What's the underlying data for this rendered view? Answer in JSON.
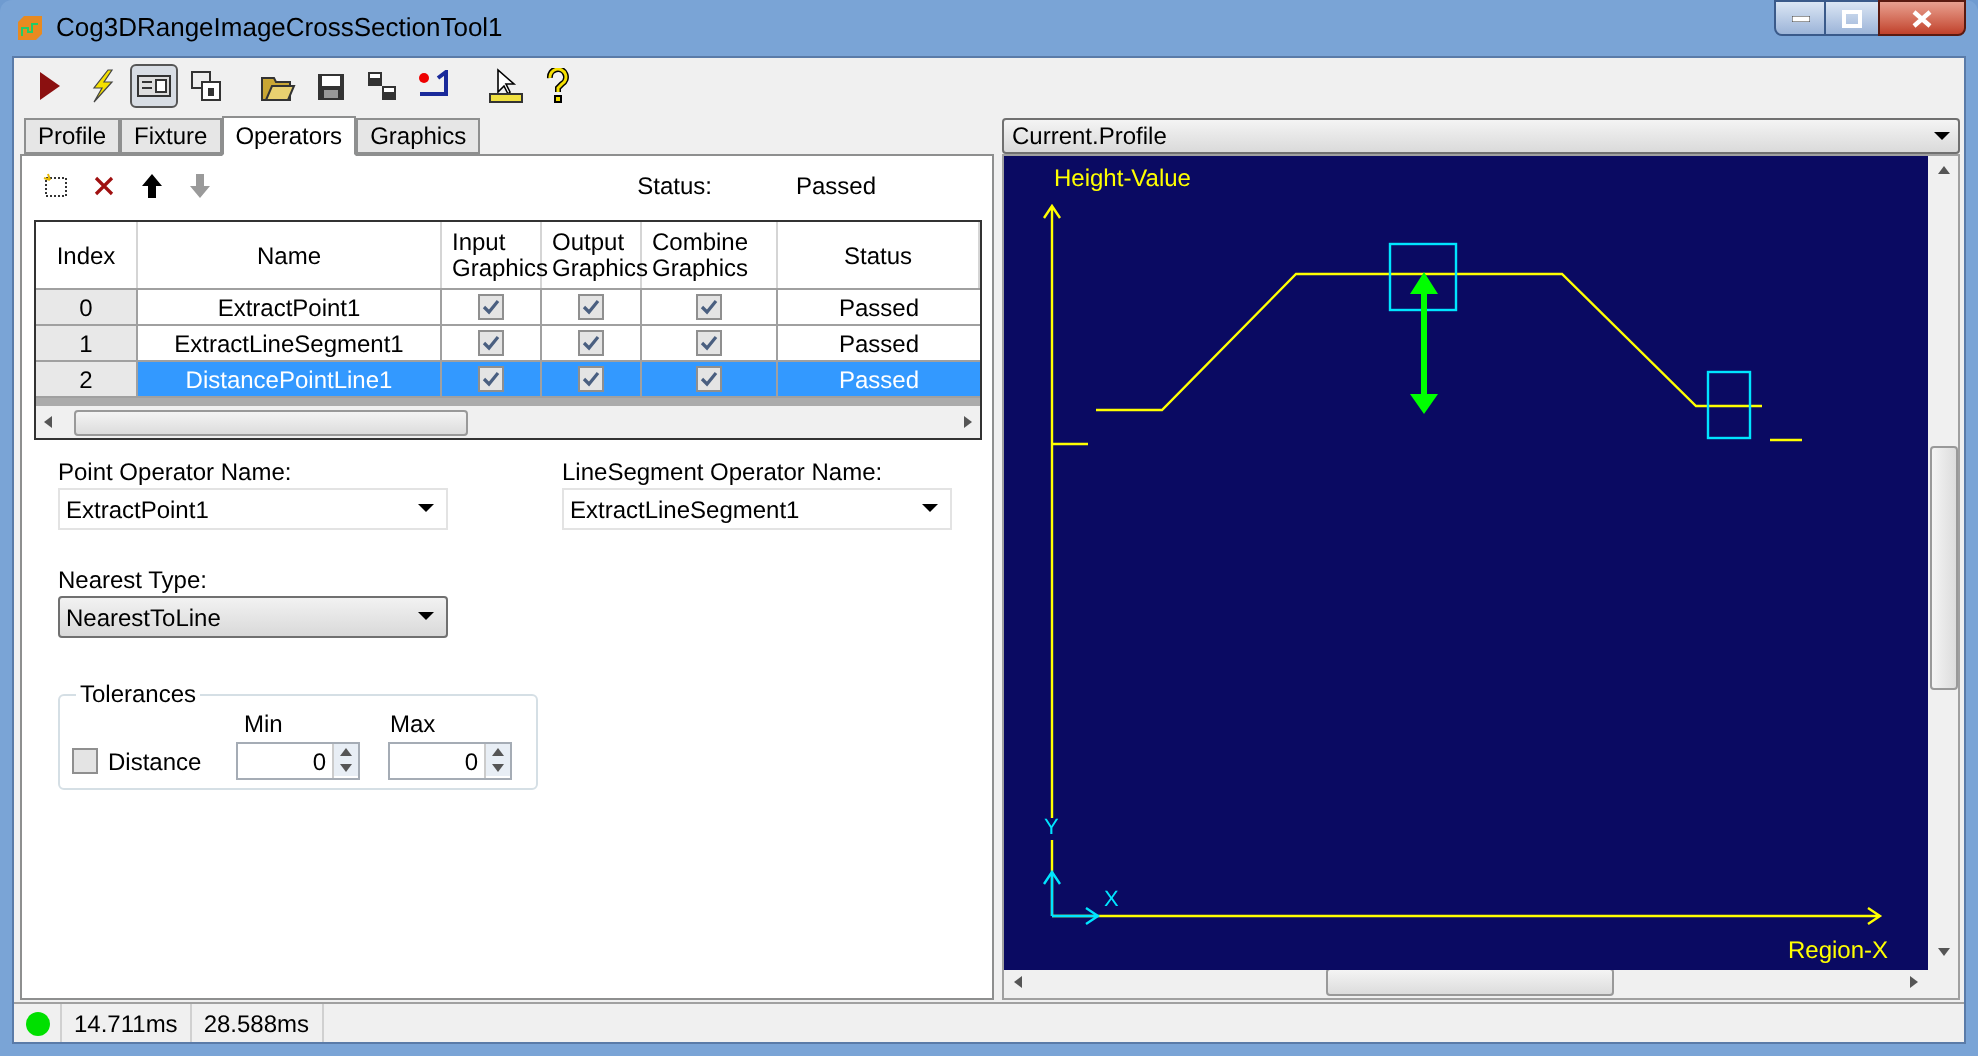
{
  "window": {
    "title": "Cog3DRangeImageCrossSectionTool1"
  },
  "toolbar_buttons": [
    {
      "kind": "run",
      "pressed": false
    },
    {
      "kind": "electric",
      "pressed": false
    },
    {
      "kind": "panel",
      "pressed": true
    },
    {
      "kind": "float",
      "pressed": false
    },
    {
      "kind": "open",
      "pressed": false
    },
    {
      "kind": "save",
      "pressed": false
    },
    {
      "kind": "saveas",
      "pressed": false
    },
    {
      "kind": "reset",
      "pressed": false
    },
    {
      "kind": "measure",
      "pressed": false
    },
    {
      "kind": "help",
      "pressed": false
    }
  ],
  "tabs": [
    {
      "label": "Profile",
      "selected": false
    },
    {
      "label": "Fixture",
      "selected": false
    },
    {
      "label": "Operators",
      "selected": true
    },
    {
      "label": "Graphics",
      "selected": false
    }
  ],
  "operator_actions": [
    {
      "kind": "add",
      "disabled": false
    },
    {
      "kind": "delete",
      "disabled": false
    },
    {
      "kind": "up",
      "disabled": false
    },
    {
      "kind": "down",
      "disabled": true
    }
  ],
  "status": {
    "label": "Status:",
    "value": "Passed"
  },
  "table": {
    "columns": [
      "Index",
      "Name",
      "Input Graphics",
      "Output Graphics",
      "Combine Graphics",
      "Status"
    ],
    "rows": [
      {
        "index": "0",
        "name": "ExtractPoint1",
        "input_graphics": true,
        "output_graphics": true,
        "combine_graphics": true,
        "status": "Passed",
        "selected": false
      },
      {
        "index": "1",
        "name": "ExtractLineSegment1",
        "input_graphics": true,
        "output_graphics": true,
        "combine_graphics": true,
        "status": "Passed",
        "selected": false
      },
      {
        "index": "2",
        "name": "DistancePointLine1",
        "input_graphics": true,
        "output_graphics": true,
        "combine_graphics": true,
        "status": "Passed",
        "selected": true
      }
    ]
  },
  "point_operator": {
    "label": "Point Operator Name:",
    "value": "ExtractPoint1"
  },
  "line_segment_operator": {
    "label": "LineSegment Operator Name:",
    "value": "ExtractLineSegment1"
  },
  "nearest_type": {
    "label": "Nearest Type:",
    "value": "NearestToLine"
  },
  "tolerances": {
    "title": "Tolerances",
    "min_label": "Min",
    "max_label": "Max",
    "distance": {
      "label": "Distance",
      "checked": false,
      "min": "0",
      "max": "0"
    }
  },
  "display": {
    "selector": "Current.Profile",
    "y_axis_label": "Height-Value",
    "x_axis_label": "Region-X",
    "x_marker": "X",
    "y_marker": "Y"
  },
  "status_bar": {
    "passed": true,
    "times": [
      "14.711ms",
      "28.588ms"
    ]
  }
}
